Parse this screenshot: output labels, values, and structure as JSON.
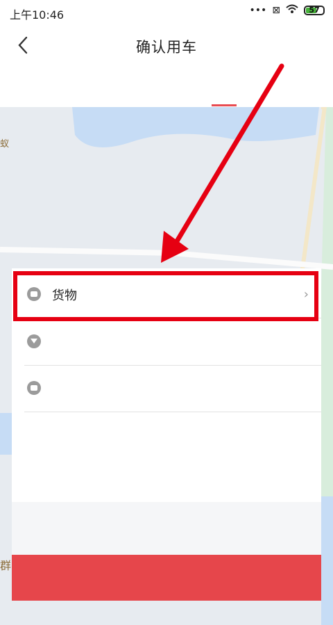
{
  "status_bar": {
    "time": "上午10:46",
    "battery": "57"
  },
  "header": {
    "title": "确认用车"
  },
  "panel": {
    "rows": [
      {
        "label": "货物"
      },
      {
        "label": ""
      },
      {
        "label": ""
      }
    ]
  },
  "map_labels": {
    "left_top": "蚁",
    "left_bottom": "群"
  },
  "colors": {
    "accent": "#e6464b",
    "highlight": "#e60012",
    "map_water": "#c6dcf5"
  },
  "icons": [
    "back-arrow-icon",
    "chevron-right-icon",
    "cargo-icon",
    "location-icon",
    "wallet-icon",
    "wifi-icon",
    "battery-icon",
    "mute-icon",
    "close-box-icon"
  ]
}
